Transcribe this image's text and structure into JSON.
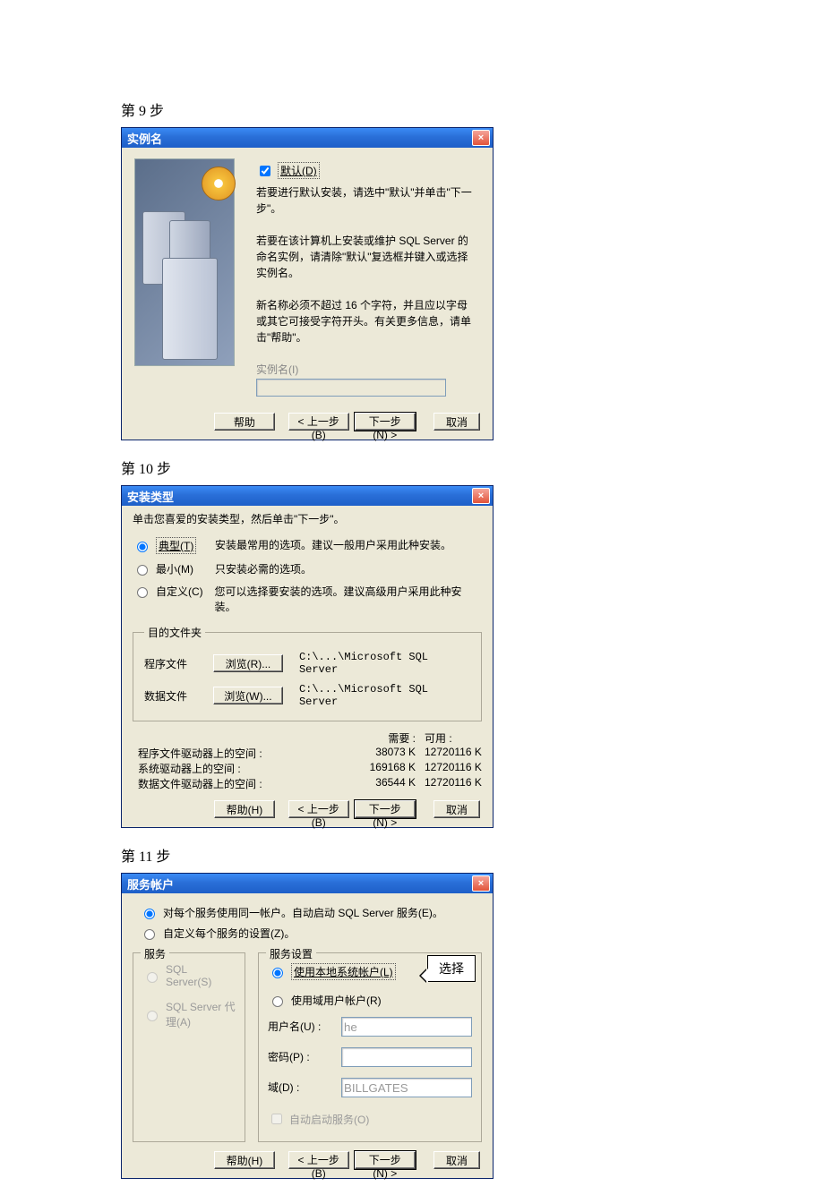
{
  "steps": {
    "s1": "第 9 步",
    "s2": "第 10 步",
    "s3": "第 11 步"
  },
  "d1": {
    "title": "实例名",
    "chk": "默认(D)",
    "p1": "若要进行默认安装，请选中\"默认\"并单击\"下一步\"。",
    "p2": "若要在该计算机上安装或维护 SQL Server 的命名实例，请清除\"默认\"复选框并键入或选择实例名。",
    "p3": "新名称必须不超过 16 个字符，并且应以字母或其它可接受字符开头。有关更多信息，请单击\"帮助\"。",
    "instlbl": "实例名(I)",
    "help": "帮助",
    "back": "< 上一步(B)",
    "next": "下一步(N) >",
    "cancel": "取消"
  },
  "d2": {
    "title": "安装类型",
    "sub": "单击您喜爱的安装类型，然后单击\"下一步\"。",
    "opt1": "典型(T)",
    "opt1d": "安装最常用的选项。建议一般用户采用此种安装。",
    "opt2": "最小(M)",
    "opt2d": "只安装必需的选项。",
    "opt3": "自定义(C)",
    "opt3d": "您可以选择要安装的选项。建议高级用户采用此种安装。",
    "fs": "目的文件夹",
    "pf": "程序文件",
    "df": "数据文件",
    "browse": "浏览(R)...",
    "browse2": "浏览(W)...",
    "path": "C:\\...\\Microsoft SQL Server",
    "req": "需要 :",
    "avail": "可用 :",
    "r1": "程序文件驱动器上的空间 :",
    "r1a": "38073 K",
    "r1b": "12720116 K",
    "r2": "系统驱动器上的空间 :",
    "r2a": "169168 K",
    "r2b": "12720116 K",
    "r3": "数据文件驱动器上的空间 :",
    "r3a": "36544 K",
    "r3b": "12720116 K",
    "help": "帮助(H)",
    "back": "< 上一步(B)",
    "next": "下一步(N) >",
    "cancel": "取消"
  },
  "d3": {
    "title": "服务帐户",
    "r1": "对每个服务使用同一帐户。自动启动 SQL Server 服务(E)。",
    "r2": "自定义每个服务的设置(Z)。",
    "svc": "服务",
    "svcset": "服务设置",
    "s1": "SQL Server(S)",
    "s2": "SQL Server 代理(A)",
    "ss1": "使用本地系统帐户(L)",
    "ss2": "使用域用户帐户(R)",
    "callout": "选择",
    "u": "用户名(U) :",
    "p": "密码(P) :",
    "d": "域(D) :",
    "uval": "he",
    "dval": "BILLGATES",
    "auto": "自动启动服务(O)",
    "help": "帮助(H)",
    "back": "< 上一步(B)",
    "next": "下一步(N) >",
    "cancel": "取消"
  }
}
